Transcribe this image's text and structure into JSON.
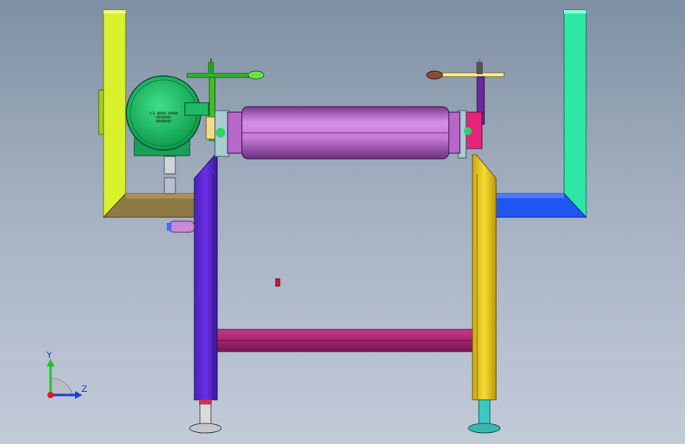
{
  "viewport": {
    "background_top": "#7f8fa3",
    "background_bottom": "#c2cbd8"
  },
  "triad": {
    "y_label": "Y",
    "z_label": "Z",
    "y_color": "#22c322",
    "z_color": "#1a3fd6",
    "origin_color": "#e11b1b"
  },
  "motor": {
    "nameplate_lines": [
      "AC0 NNNNN NNNNN",
      "NNNNNNNN",
      "NNNNNNNN"
    ],
    "color": "#17c060"
  },
  "parts": {
    "roller_color": "#c77ad6",
    "left_leg_color": "#6a2fe6",
    "right_leg_color": "#f2d22a",
    "cross_beam_color": "#a3246f",
    "left_frame_color": "#d9f22b",
    "right_frame_color": "#2fe6a6",
    "right_bracket_color": "#2155f2"
  }
}
